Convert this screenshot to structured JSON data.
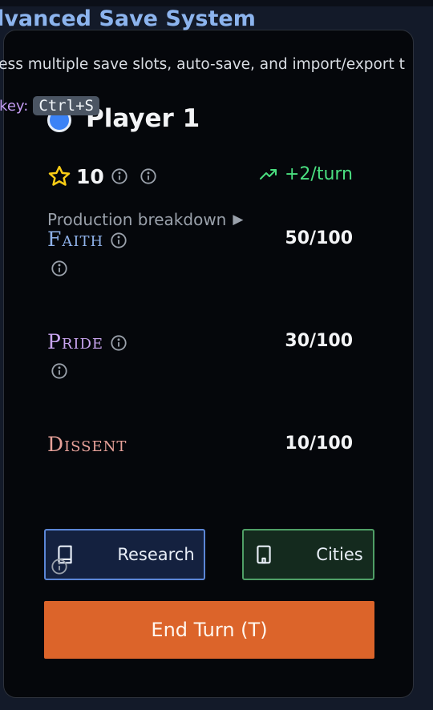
{
  "tooltip": {
    "title": "dvanced Save System",
    "description": "cess multiple save slots, auto-save, and import/export t",
    "hotkey_label": "tkey:",
    "hotkey": "Ctrl+S"
  },
  "player": {
    "name": "Player 1",
    "color": "#3b82f6"
  },
  "score": {
    "value": "10",
    "rate": "+2/turn"
  },
  "breakdown_label": "Production breakdown",
  "resources": [
    {
      "name": "Faith",
      "value": "50/100",
      "color": "#8fb2ea"
    },
    {
      "name": "Pride",
      "value": "30/100",
      "color": "#c9a6f1"
    },
    {
      "name": "Dissent",
      "value": "10/100",
      "color": "#e8a29a"
    }
  ],
  "buttons": {
    "research": "Research",
    "cities": "Cities",
    "end_turn": "End Turn (T)"
  },
  "colors": {
    "panel_bg": "#05070b",
    "accent_orange": "#dc642a",
    "rate_green": "#4ade80",
    "research_border": "#5b86d6",
    "cities_border": "#4f9f66"
  },
  "icons": {
    "star": "star-icon",
    "info": "info-icon",
    "trend": "trending-up-icon",
    "book": "book-icon",
    "building": "building-icon"
  }
}
